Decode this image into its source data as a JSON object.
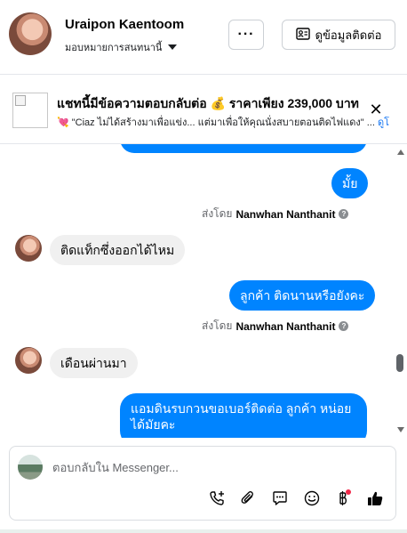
{
  "header": {
    "contact_name": "Uraipon Kaentoom",
    "assign_label": "มอบหมายการสนทนานี้",
    "more_label": "···",
    "contact_info_label": "ดูข้อมูลติดต่อ"
  },
  "ad": {
    "title": "แชทนี้มีข้อความตอบกลับต่อ 💰 ราคาเพียง 239,000 บาท",
    "subtitle": "💘 \"Ciaz ไม่ได้สร้างมาเพื่อแข่ง... แต่มาเพื่อให้คุณนั่งสบายตอนติดไฟแดง\" ...",
    "link": "ดูโ",
    "close_label": "✕"
  },
  "messages": [
    {
      "type": "outgoing",
      "text": "มั้ย"
    },
    {
      "type": "sentby",
      "prefix": "ส่งโดย",
      "name": "Nanwhan Nanthanit"
    },
    {
      "type": "incoming",
      "text": "ติดแท็กซึ่งออกได้ไหม"
    },
    {
      "type": "outgoing",
      "text": "ลูกค้า ติดนานหรือยังคะ"
    },
    {
      "type": "sentby",
      "prefix": "ส่งโดย",
      "name": "Nanwhan Nanthanit"
    },
    {
      "type": "incoming",
      "text": "เดือนผ่านมา"
    },
    {
      "type": "outgoing",
      "text": "แอมดินรบกวนขอเบอร์ติดต่อ ลูกค้า หน่อยได้มัยคะ"
    }
  ],
  "composer": {
    "placeholder": "ตอบกลับใน Messenger...",
    "tools": [
      "phone-add-icon",
      "paperclip-icon",
      "chat-bubble-icon",
      "smiley-icon",
      "baht-icon",
      "like-icon"
    ]
  },
  "colors": {
    "outgoing_bubble": "#0084ff",
    "incoming_bubble": "#f0f0f0",
    "accent": "#1877f2",
    "notification_dot": "#f02849"
  }
}
